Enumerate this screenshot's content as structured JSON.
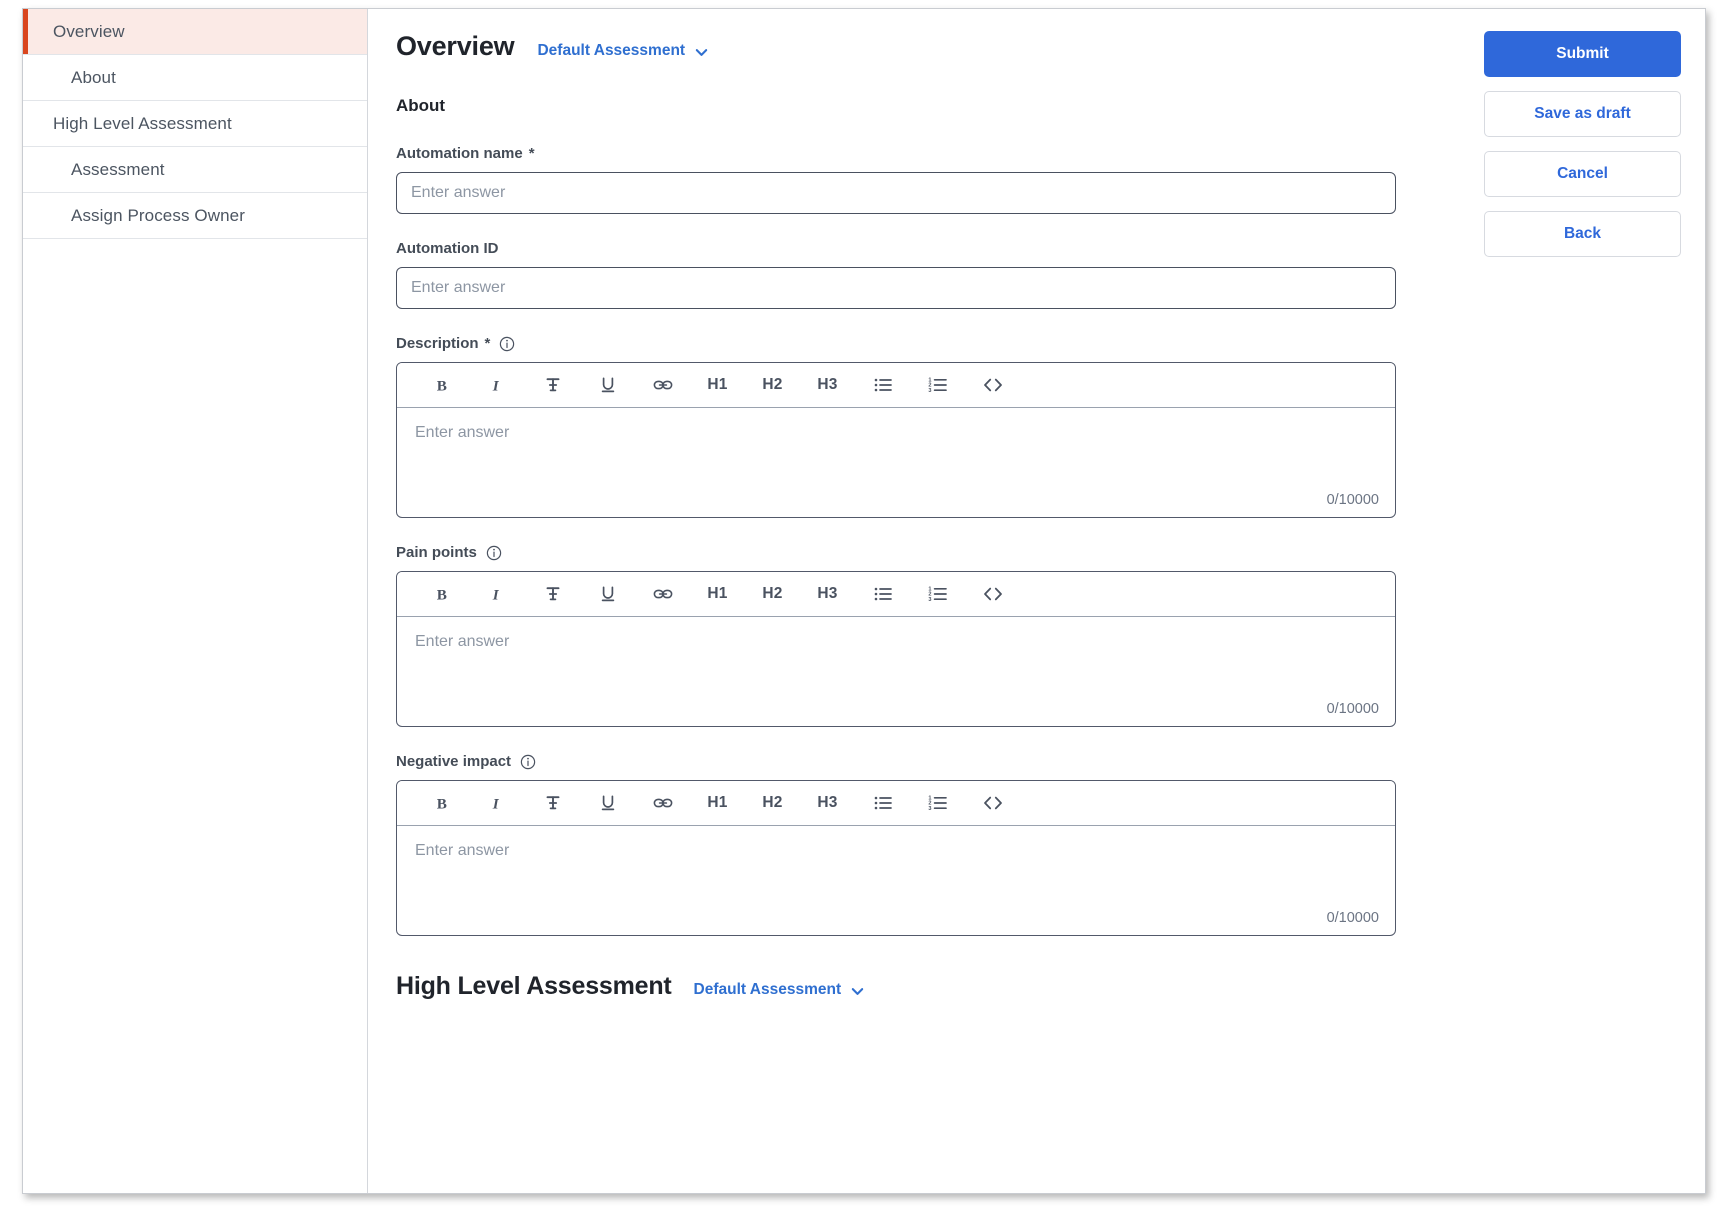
{
  "sidebar": {
    "items": [
      {
        "label": "Overview",
        "level": 1,
        "active": true
      },
      {
        "label": "About",
        "level": 2,
        "active": false
      },
      {
        "label": "High Level Assessment",
        "level": 1,
        "active": false
      },
      {
        "label": "Assessment",
        "level": 2,
        "active": false
      },
      {
        "label": "Assign Process Owner",
        "level": 2,
        "active": false
      }
    ]
  },
  "header": {
    "title": "Overview",
    "assessment_selector": "Default Assessment"
  },
  "about_section": {
    "heading": "About"
  },
  "fields": {
    "automation_name": {
      "label": "Automation name",
      "required_marker": "*",
      "placeholder": "Enter answer",
      "value": ""
    },
    "automation_id": {
      "label": "Automation ID",
      "required_marker": "",
      "placeholder": "Enter answer",
      "value": ""
    },
    "description": {
      "label": "Description",
      "required_marker": "*",
      "has_info": true,
      "placeholder": "Enter answer",
      "value": "",
      "char_count": "0/10000"
    },
    "pain_points": {
      "label": "Pain points",
      "required_marker": "",
      "has_info": true,
      "placeholder": "Enter answer",
      "value": "",
      "char_count": "0/10000"
    },
    "negative_impact": {
      "label": "Negative impact",
      "required_marker": "",
      "has_info": true,
      "placeholder": "Enter answer",
      "value": "",
      "char_count": "0/10000"
    }
  },
  "editor_toolbar": {
    "buttons": [
      {
        "name": "bold-icon",
        "label": "B",
        "kind": "icon"
      },
      {
        "name": "italic-icon",
        "label": "I",
        "kind": "icon"
      },
      {
        "name": "strikethrough-icon",
        "label": "S",
        "kind": "icon"
      },
      {
        "name": "underline-icon",
        "label": "U",
        "kind": "icon"
      },
      {
        "name": "link-icon",
        "label": "Link",
        "kind": "icon"
      },
      {
        "name": "heading-1-button",
        "label": "H1",
        "kind": "text"
      },
      {
        "name": "heading-2-button",
        "label": "H2",
        "kind": "text"
      },
      {
        "name": "heading-3-button",
        "label": "H3",
        "kind": "text"
      },
      {
        "name": "bullet-list-icon",
        "label": "Bullet list",
        "kind": "icon"
      },
      {
        "name": "numbered-list-icon",
        "label": "Numbered list",
        "kind": "icon"
      },
      {
        "name": "code-icon",
        "label": "Code",
        "kind": "icon"
      }
    ]
  },
  "bottom_section": {
    "title": "High Level Assessment",
    "assessment_selector": "Default Assessment"
  },
  "actions": {
    "submit": "Submit",
    "save_as_draft": "Save as draft",
    "cancel": "Cancel",
    "back": "Back"
  },
  "colors": {
    "primary": "#2f68da",
    "active_nav_bg": "#fbeae6",
    "active_nav_bar": "#d9461e",
    "link": "#2f6fd0"
  }
}
